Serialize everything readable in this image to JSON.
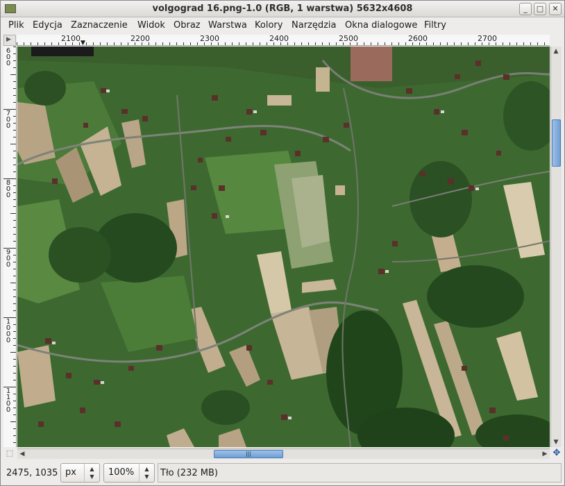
{
  "window": {
    "title": "volgograd 16.png-1.0 (RGB, 1 warstwa) 5632x4608",
    "buttons": {
      "minimize": "_",
      "maximize": "□",
      "close": "✕"
    }
  },
  "menubar": {
    "items": [
      "Plik",
      "Edycja",
      "Zaznaczenie",
      "Widok",
      "Obraz",
      "Warstwa",
      "Kolory",
      "Narzędzia",
      "Okna dialogowe",
      "Filtry"
    ]
  },
  "rulers": {
    "horizontal": [
      "2100",
      "2200",
      "2300",
      "2400",
      "2500",
      "2600",
      "2700"
    ],
    "vertical": [
      "600",
      "700",
      "800",
      "900",
      "1000",
      "1100"
    ]
  },
  "image": {
    "description_icon": "aerial-photo",
    "colors": {
      "dark_green": "#2c4d25",
      "field_green": "#4f7d3a",
      "light_field": "#c8b99c",
      "road": "#8b8f86"
    }
  },
  "scrollbars": {
    "vertical_position": 0.2,
    "horizontal_position": 0.4,
    "hthumb_grip": "|||"
  },
  "statusbar": {
    "coordinates": "2475, 1035",
    "unit": "px",
    "zoom": "100%",
    "message": "Tło (232 MB)"
  }
}
